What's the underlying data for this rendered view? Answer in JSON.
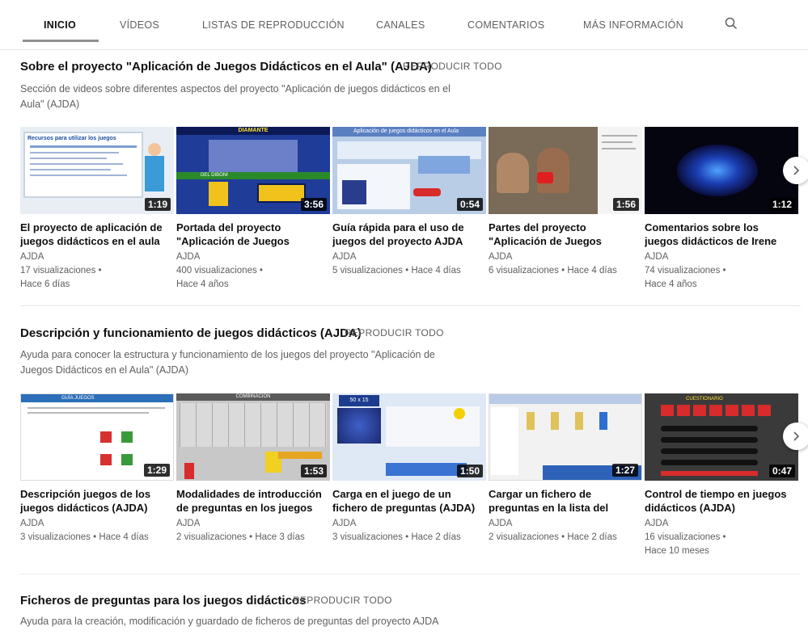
{
  "tabs": [
    {
      "label": "INICIO",
      "active": true
    },
    {
      "label": "VÍDEOS"
    },
    {
      "label": "LISTAS DE REPRODUCCIÓN"
    },
    {
      "label": "CANALES"
    },
    {
      "label": "COMENTARIOS"
    },
    {
      "label": "MÁS INFORMACIÓN"
    }
  ],
  "search_icon": "search-icon",
  "sections": [
    {
      "title": "Sobre el proyecto \"Aplicación de Juegos Didácticos en el Aula\" (AJDA)",
      "play_all": "REPRODUCIR TODO",
      "desc_line1": "Sección de videos sobre diferentes aspectos del proyecto \"Aplicación de juegos didácticos en el",
      "desc_line2": "Aula\" (AJDA)",
      "videos": [
        {
          "title1": "El proyecto de aplicación de",
          "title2": "juegos didácticos en el aula",
          "channel": "AJDA",
          "meta1": "17 visualizaciones •",
          "meta2": "Hace 6 días",
          "duration": "1:19"
        },
        {
          "title1": "Portada del proyecto",
          "title2": "\"Aplicación de Juegos",
          "channel": "AJDA",
          "meta1": "400 visualizaciones •",
          "meta2": "Hace 4 años",
          "duration": "3:56"
        },
        {
          "title1": "Guía rápida para el uso de",
          "title2": "juegos del proyecto AJDA",
          "channel": "AJDA",
          "meta1": "5 visualizaciones • Hace 4 días",
          "meta2": "",
          "duration": "0:54"
        },
        {
          "title1": "Partes del proyecto",
          "title2": "\"Aplicación de Juegos",
          "channel": "AJDA",
          "meta1": "6 visualizaciones • Hace 4 días",
          "meta2": "",
          "duration": "1:56"
        },
        {
          "title1": "Comentarios sobre los",
          "title2": "juegos didácticos de Irene",
          "channel": "AJDA",
          "meta1": "74 visualizaciones •",
          "meta2": "Hace 4 años",
          "duration": "1:12"
        }
      ]
    },
    {
      "title": "Descripción y funcionamiento de juegos didácticos (AJDA)",
      "play_all": "REPRODUCIR TODO",
      "desc_line1": "Ayuda para conocer la estructura y funcionamiento de los juegos del proyecto \"Aplicación de",
      "desc_line2": "Juegos Didácticos en el Aula\" (AJDA)",
      "videos": [
        {
          "title1": "Descripción juegos de los",
          "title2": "juegos didácticos (AJDA)",
          "channel": "AJDA",
          "meta1": "3 visualizaciones • Hace 4 días",
          "meta2": "",
          "duration": "1:29"
        },
        {
          "title1": "Modalidades de introducción",
          "title2": "de preguntas en los juegos",
          "channel": "AJDA",
          "meta1": "2 visualizaciones • Hace 3 días",
          "meta2": "",
          "duration": "1:53"
        },
        {
          "title1": "Carga en el juego de un",
          "title2": "fichero de preguntas (AJDA)",
          "channel": "AJDA",
          "meta1": "3 visualizaciones • Hace 2 días",
          "meta2": "",
          "duration": "1:50"
        },
        {
          "title1": "Cargar un fichero de",
          "title2": "preguntas en la lista del",
          "channel": "AJDA",
          "meta1": "2 visualizaciones • Hace 2 días",
          "meta2": "",
          "duration": "1:27"
        },
        {
          "title1": "Control de tiempo en juegos",
          "title2": "didácticos (AJDA)",
          "channel": "AJDA",
          "meta1": "16 visualizaciones •",
          "meta2": "Hace 10 meses",
          "duration": "0:47"
        }
      ]
    },
    {
      "title": "Ficheros de preguntas para los juegos didácticos",
      "play_all": "REPRODUCIR TODO",
      "desc_line1": "Ayuda para la creación, modificación y guardado de ficheros de preguntas del proyecto AJDA"
    }
  ],
  "thumb_texts": {
    "t1_heading": "Recursos para utilizar los juegos",
    "t2_top": "DIAMANTE",
    "t2_mid": "DEL DIBONI",
    "t3_heading": "Aplicación de juegos didácticos en el Aula",
    "t6_heading": "GUÍA JUEGOS",
    "t7_heading": "COMBINACION",
    "t8_heading": "50 x 15",
    "t10_heading": "CUESTIONARIO"
  },
  "colors": {
    "accent": "#0f0f0f",
    "muted": "#606060",
    "duration_bg": "#000000"
  }
}
